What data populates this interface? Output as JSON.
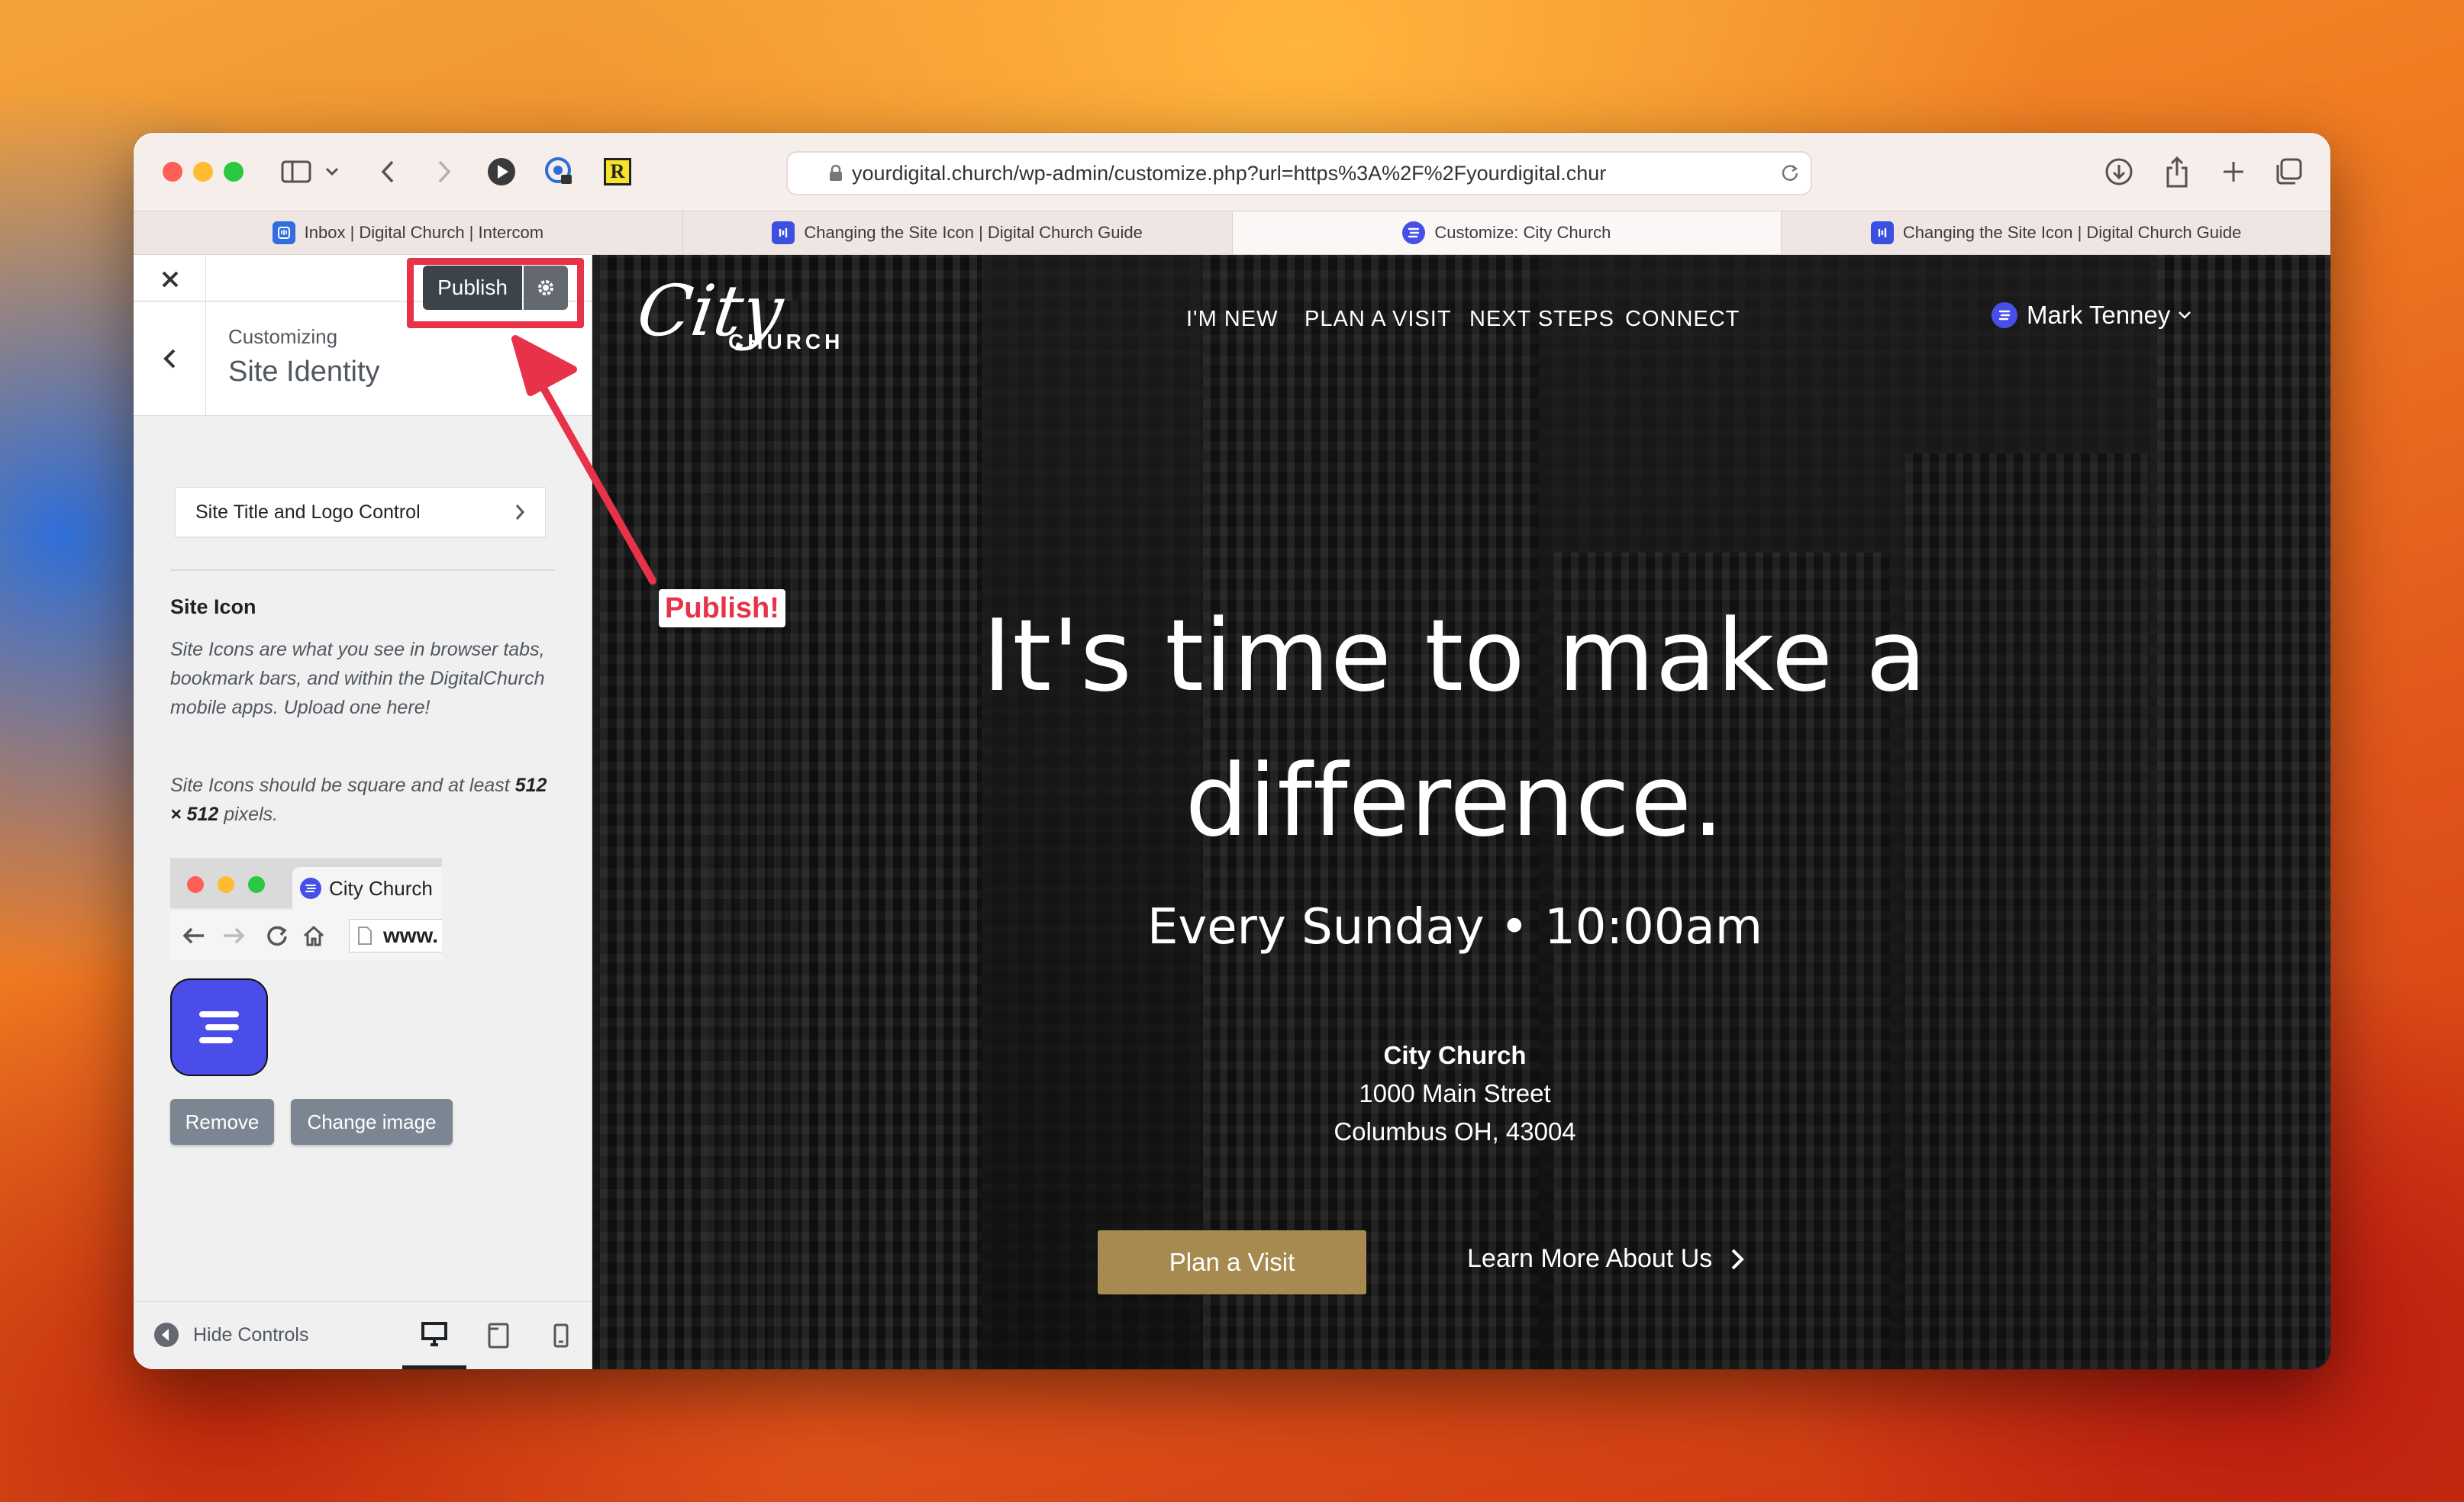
{
  "browser": {
    "url": "yourdigital.church/wp-admin/customize.php?url=https%3A%2F%2Fyourdigital.chur",
    "tabs": [
      {
        "label": "Inbox | Digital Church | Intercom"
      },
      {
        "label": "Changing the Site Icon | Digital Church Guide"
      },
      {
        "label": "Customize: City Church"
      },
      {
        "label": "Changing the Site Icon | Digital Church Guide"
      }
    ]
  },
  "customizer": {
    "publish_label": "Publish",
    "customizing_label": "Customizing",
    "section_title": "Site Identity",
    "site_title_control": "Site Title and Logo Control",
    "site_icon_heading": "Site Icon",
    "description_1": "Site Icons are what you see in browser tabs, bookmark bars, and within the DigitalChurch mobile apps. Upload one here!",
    "description_2_prefix": "Site Icons should be square and at least ",
    "description_2_bold": "512 × 512",
    "description_2_suffix": " pixels.",
    "preview_tab_title": "City Church",
    "preview_url": "www.",
    "remove_label": "Remove",
    "change_image_label": "Change image",
    "hide_controls_label": "Hide Controls"
  },
  "annotation": {
    "label": "Publish!",
    "color": "#e8324a"
  },
  "site": {
    "logo_script": "City",
    "logo_word": "CHURCH",
    "nav": [
      "I'M NEW",
      "PLAN A VISIT",
      "NEXT STEPS",
      "CONNECT"
    ],
    "user_name": "Mark Tenney",
    "headline_line1": "It's time to make a",
    "headline_line2": "difference.",
    "service_time": "Every Sunday • 10:00am",
    "address_name": "City Church",
    "address_street": "1000 Main Street",
    "address_city": "Columbus OH, 43004",
    "cta_primary": "Plan a Visit",
    "cta_secondary": "Learn More About Us",
    "accent_color": "#a68a4f"
  }
}
